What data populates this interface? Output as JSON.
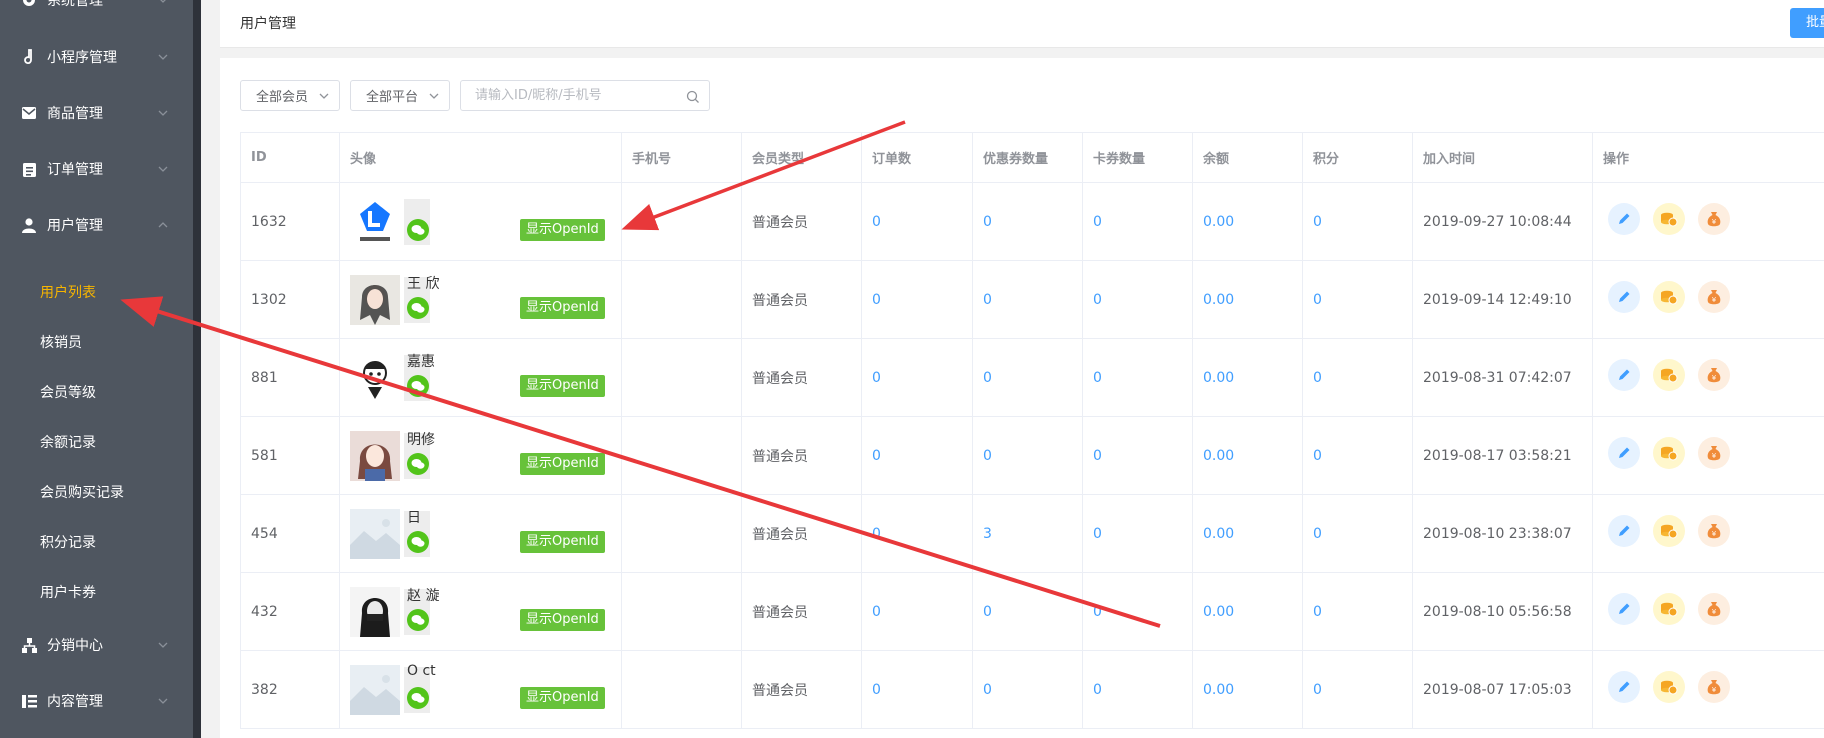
{
  "sidebar": {
    "items": [
      {
        "label": "系统管理",
        "icon": "gear-icon"
      },
      {
        "label": "小程序管理",
        "icon": "music-note-icon"
      },
      {
        "label": "商品管理",
        "icon": "envelope-icon"
      },
      {
        "label": "订单管理",
        "icon": "clipboard-icon"
      },
      {
        "label": "用户管理",
        "icon": "user-icon"
      },
      {
        "label": "分销中心",
        "icon": "org-chart-icon"
      },
      {
        "label": "内容管理",
        "icon": "content-icon"
      }
    ],
    "sub_items": [
      "用户列表",
      "核销员",
      "会员等级",
      "余额记录",
      "会员购买记录",
      "积分记录",
      "用户卡券"
    ],
    "active_sub": "用户列表"
  },
  "header": {
    "title": "用户管理",
    "batch_label": "批量"
  },
  "filters": {
    "member": "全部会员",
    "platform": "全部平台",
    "search_placeholder": "请输入ID/昵称/手机号"
  },
  "table": {
    "columns": [
      "ID",
      "头像",
      "手机号",
      "会员类型",
      "订单数",
      "优惠券数量",
      "卡券数量",
      "余额",
      "积分",
      "加入时间",
      "操作"
    ],
    "openid_label": "显示OpenId",
    "rows": [
      {
        "id": "1632",
        "nickname": "",
        "phone": "",
        "type": "普通会员",
        "orders": "0",
        "coupons": "0",
        "cards": "0",
        "balance": "0.00",
        "points": "0",
        "joined": "2019-09-27 10:08:44",
        "avatar": "logo"
      },
      {
        "id": "1302",
        "nickname": "王 欣",
        "phone": "",
        "type": "普通会员",
        "orders": "0",
        "coupons": "0",
        "cards": "0",
        "balance": "0.00",
        "points": "0",
        "joined": "2019-09-14 12:49:10",
        "avatar": "girl"
      },
      {
        "id": "881",
        "nickname": "嘉惠",
        "phone": "",
        "type": "普通会员",
        "orders": "0",
        "coupons": "0",
        "cards": "0",
        "balance": "0.00",
        "points": "0",
        "joined": "2019-08-31 07:42:07",
        "avatar": "cartoon"
      },
      {
        "id": "581",
        "nickname": "明修",
        "phone": "",
        "type": "普通会员",
        "orders": "0",
        "coupons": "0",
        "cards": "0",
        "balance": "0.00",
        "points": "0",
        "joined": "2019-08-17 03:58:21",
        "avatar": "anime"
      },
      {
        "id": "454",
        "nickname": "日",
        "phone": "",
        "type": "普通会员",
        "orders": "0",
        "coupons": "3",
        "cards": "0",
        "balance": "0.00",
        "points": "0",
        "joined": "2019-08-10 23:38:07",
        "avatar": "default"
      },
      {
        "id": "432",
        "nickname": "赵 漩",
        "phone": "",
        "type": "普通会员",
        "orders": "0",
        "coupons": "0",
        "cards": "0",
        "balance": "0.00",
        "points": "0",
        "joined": "2019-08-10 05:56:58",
        "avatar": "dark"
      },
      {
        "id": "382",
        "nickname": "O  ct",
        "phone": "",
        "type": "普通会员",
        "orders": "0",
        "coupons": "0",
        "cards": "0",
        "balance": "0.00",
        "points": "0",
        "joined": "2019-08-07 17:05:03",
        "avatar": "default"
      }
    ]
  },
  "colors": {
    "accent": "#409eff",
    "sidebar_bg": "#4f5660",
    "active_sub": "#f7b500",
    "openid_green": "#67c23a",
    "annotation_red": "#e8383a"
  }
}
